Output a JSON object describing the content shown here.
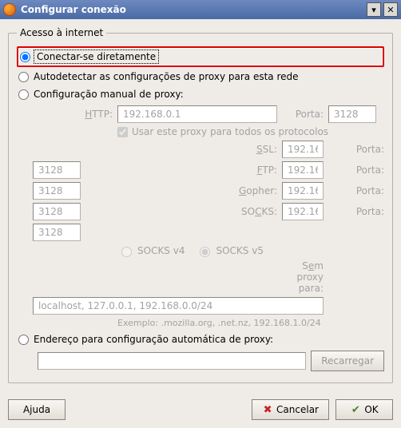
{
  "window": {
    "title": "Configurar conexão"
  },
  "group": {
    "legend": "Acesso à internet",
    "opt_direct": "Conectar-se diretamente",
    "opt_auto": "Autodetectar as configurações de proxy para esta rede",
    "opt_manual": "Configuração manual de proxy:",
    "opt_pac": "Endereço para configuração automática de proxy:"
  },
  "labels": {
    "http": "HTTP:",
    "port": "Porta:",
    "ssl": "SSL:",
    "ftp": "FTP:",
    "gopher": "Gopher:",
    "socks": "SOCKS:",
    "noproxy": "Sem proxy para:",
    "use_all": "Usar este proxy para todos os protocolos",
    "socks4": "SOCKS v4",
    "socks5": "SOCKS v5",
    "example": "Exemplo: .mozilla.org, .net.nz, 192.168.1.0/24",
    "reload": "Recarregar"
  },
  "values": {
    "host": "192.168.0.1",
    "port": "3128",
    "noproxy": "localhost, 127.0.0.1, 192.168.0.0/24",
    "pac_url": ""
  },
  "buttons": {
    "help": "Ajuda",
    "cancel": "Cancelar",
    "ok": "OK"
  }
}
